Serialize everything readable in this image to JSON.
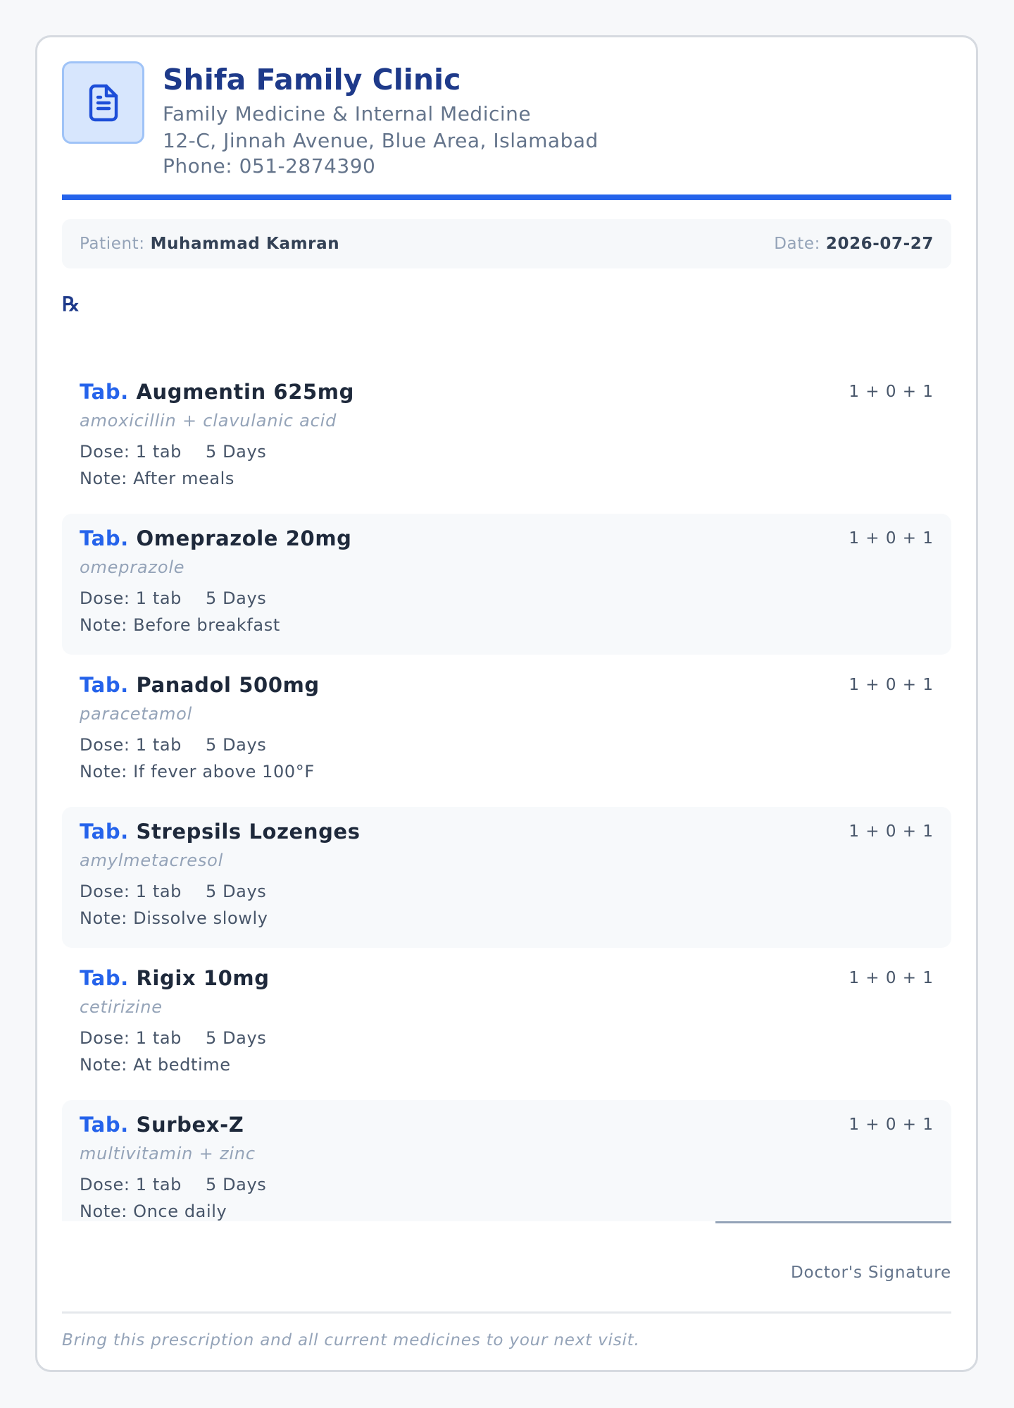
{
  "clinic": {
    "icon": "document-icon",
    "name": "Shifa Family Clinic",
    "specialty": "Family Medicine & Internal Medicine",
    "address": "12-C, Jinnah Avenue, Blue Area, Islamabad",
    "phone": "Phone: 051-2874390",
    "accent_color": "#2563eb"
  },
  "patient": {
    "label": "Patient:",
    "name": "Muhammad Kamran",
    "date_label": "Date:",
    "date": "2026-07-27"
  },
  "rx_symbol": "℞",
  "medicines": [
    {
      "form": "Tab.",
      "name": "Augmentin 625mg",
      "generic": "amoxicillin + clavulanic acid",
      "dose": "Dose: 1 tab",
      "duration": "5 Days",
      "note": "Note: After meals",
      "frequency": "1 + 0 + 1"
    },
    {
      "form": "Tab.",
      "name": "Omeprazole 20mg",
      "generic": "omeprazole",
      "dose": "Dose: 1 tab",
      "duration": "5 Days",
      "note": "Note: Before breakfast",
      "frequency": "1 + 0 + 1"
    },
    {
      "form": "Tab.",
      "name": "Panadol 500mg",
      "generic": "paracetamol",
      "dose": "Dose: 1 tab",
      "duration": "5 Days",
      "note": "Note: If fever above 100°F",
      "frequency": "1 + 0 + 1"
    },
    {
      "form": "Tab.",
      "name": "Strepsils Lozenges",
      "generic": "amylmetacresol",
      "dose": "Dose: 1 tab",
      "duration": "5 Days",
      "note": "Note: Dissolve slowly",
      "frequency": "1 + 0 + 1"
    },
    {
      "form": "Tab.",
      "name": "Rigix 10mg",
      "generic": "cetirizine",
      "dose": "Dose: 1 tab",
      "duration": "5 Days",
      "note": "Note: At bedtime",
      "frequency": "1 + 0 + 1"
    },
    {
      "form": "Tab.",
      "name": "Surbex-Z",
      "generic": "multivitamin + zinc",
      "dose": "Dose: 1 tab",
      "duration": "5 Days",
      "note": "Note: Once daily",
      "frequency": "1 + 0 + 1"
    }
  ],
  "signature_label": "Doctor's Signature",
  "footer_note": "Bring this prescription and all current medicines to your next visit."
}
